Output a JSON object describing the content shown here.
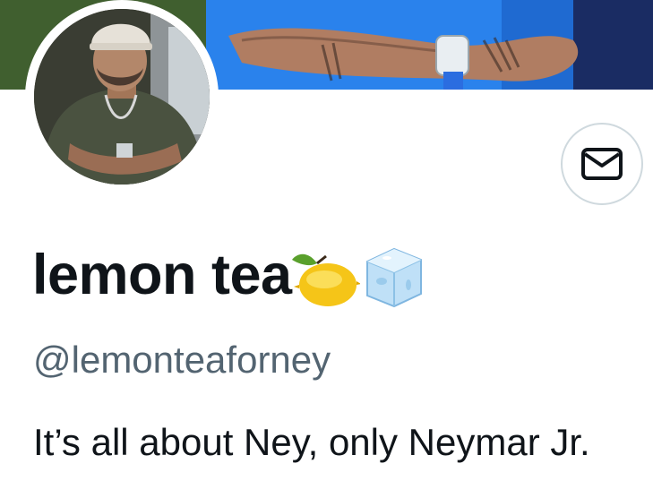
{
  "profile": {
    "display_name": "lemon tea",
    "name_emojis": [
      "lemon-emoji",
      "ice-cube-emoji"
    ],
    "handle": "@lemonteaforney",
    "bio": "It’s all about Ney, only Neymar Jr."
  },
  "actions": {
    "message_icon": "envelope-icon"
  },
  "colors": {
    "text_primary": "#0f1419",
    "text_secondary": "#536471",
    "button_border": "#cfd9de"
  }
}
